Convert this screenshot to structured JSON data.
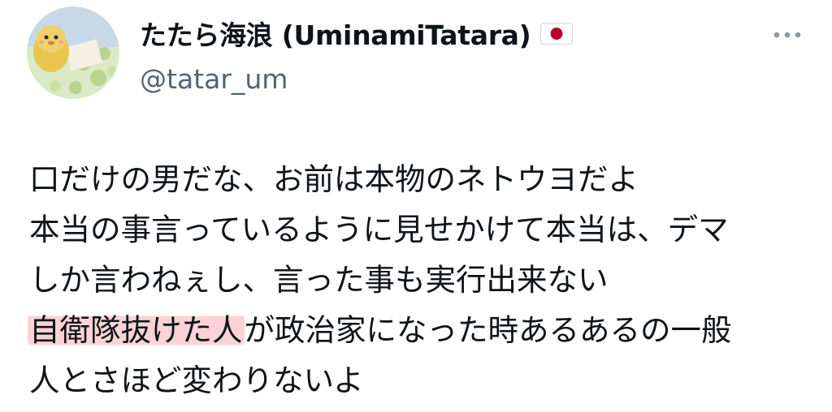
{
  "author": {
    "display_name": "たたら海浪 (UminamiTatara)",
    "handle": "@tatar_um",
    "flag_icon": "japan-flag-icon"
  },
  "more_icon": "more-horizontal-icon",
  "colors": {
    "text_primary": "#0f1419",
    "text_secondary": "#536471",
    "highlight": "#fbd3d6",
    "flag_red": "#bc002d"
  },
  "tweet": {
    "lines": [
      "口だけの男だな、お前は本物のネトウヨだよ",
      "本当の事言っているように見せかけて本当は、デマ",
      "しか言わねぇし、言った事も実行出来ない"
    ],
    "highlighted_phrase": "自衛隊抜けた人",
    "line4_rest": "が政治家になった時あるあるの一般",
    "line5": "人とさほど変わりないよ"
  }
}
